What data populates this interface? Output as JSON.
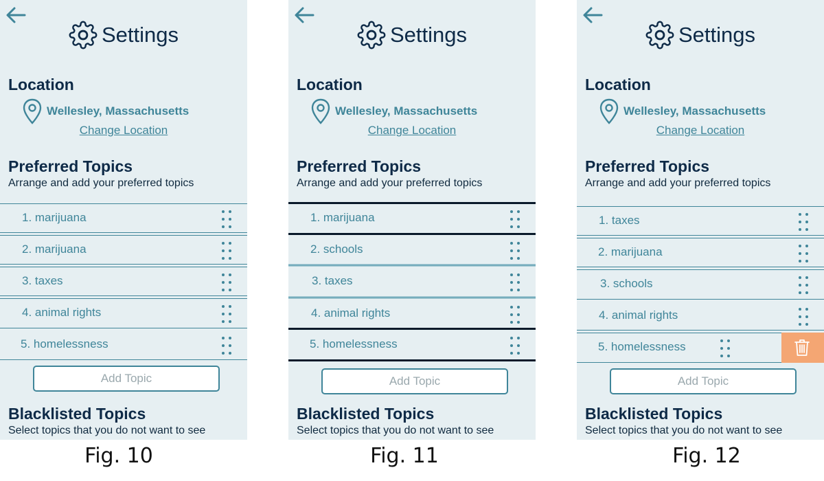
{
  "colors": {
    "panel_bg": "#e6eff2",
    "accent": "#3f8599",
    "heading": "#0e2a47",
    "delete_bg": "#f4a673"
  },
  "icons": [
    "back-arrow-icon",
    "gear-icon",
    "location-pin-icon",
    "drag-handle-icon",
    "trash-icon"
  ],
  "figures": [
    {
      "caption": "Fig. 10",
      "header": {
        "title": "Settings"
      },
      "location": {
        "heading": "Location",
        "city": "Wellesley, Massachusetts",
        "change_link": "Change Location"
      },
      "preferred": {
        "heading": "Preferred Topics",
        "subtitle": "Arrange and add your preferred topics",
        "topics": [
          "1. marijuana",
          "2. marijuana",
          "3. taxes",
          "4. animal rights",
          "5. homelessness"
        ],
        "add_button": "Add Topic"
      },
      "blacklisted": {
        "heading": "Blacklisted Topics",
        "subtitle": "Select topics that you do not want to see"
      }
    },
    {
      "caption": "Fig. 11",
      "header": {
        "title": "Settings"
      },
      "location": {
        "heading": "Location",
        "city": "Wellesley, Massachusetts",
        "change_link": "Change Location"
      },
      "preferred": {
        "heading": "Preferred Topics",
        "subtitle": "Arrange and add your preferred topics",
        "topics": [
          "1. marijuana",
          "2. schools",
          "3. taxes",
          "4. animal rights",
          "5. homelessness"
        ],
        "add_button": "Add Topic"
      },
      "blacklisted": {
        "heading": "Blacklisted Topics",
        "subtitle": "Select topics that you do not want to see"
      }
    },
    {
      "caption": "Fig. 12",
      "header": {
        "title": "Settings"
      },
      "location": {
        "heading": "Location",
        "city": "Wellesley, Massachusetts",
        "change_link": "Change Location"
      },
      "preferred": {
        "heading": "Preferred Topics",
        "subtitle": "Arrange and add your preferred topics",
        "topics": [
          "1. taxes",
          "2. marijuana",
          "3. schools",
          "4. animal rights",
          "5. homelessness"
        ],
        "add_button": "Add Topic"
      },
      "blacklisted": {
        "heading": "Blacklisted Topics",
        "subtitle": "Select topics that you do not want to see"
      }
    }
  ]
}
